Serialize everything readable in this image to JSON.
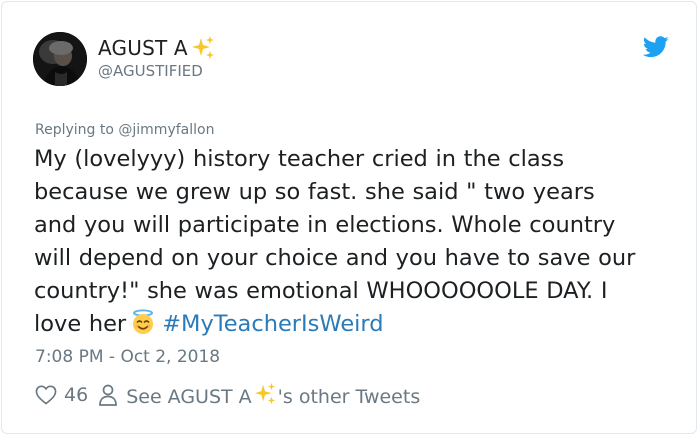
{
  "user": {
    "display_name": "AGUST A",
    "handle": "@AGUSTIFIED"
  },
  "reply": {
    "prefix": "Replying to ",
    "mention": "@jimmyfallon"
  },
  "tweet": {
    "lines": [
      "My (lovelyyy) history teacher cried in the class",
      "because we grew up so fast. she said \" two years",
      "and you will participate in elections. Whole country",
      "will depend on your choice and you have to save our",
      "country!\" she was emotional WHOOOOOOLE DAY. I"
    ],
    "last_line_start": "love her",
    "hashtag": "#MyTeacherIsWeird"
  },
  "timestamp": "7:08 PM - Oct 2, 2018",
  "actions": {
    "like_count": "46",
    "see_prefix": "See AGUST A",
    "see_suffix": "'s other Tweets"
  },
  "icons": {
    "twitter": "twitter-bird-icon",
    "like": "heart-icon",
    "profile": "person-icon",
    "sparkles": "sparkles-emoji",
    "halo": "smiling-face-with-halo-emoji"
  },
  "colors": {
    "link": "#2b7bb9",
    "twitter_blue": "#1da1f2",
    "muted": "#697882",
    "text": "#1c2022"
  }
}
